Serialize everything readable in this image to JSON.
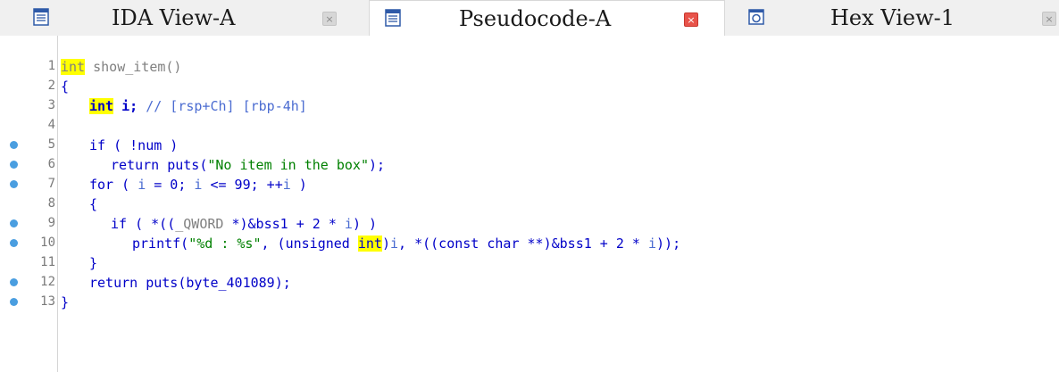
{
  "tabs": [
    {
      "label": "IDA View-A",
      "icon": "disassembly-view-icon",
      "close": "×"
    },
    {
      "label": "Pseudocode-A",
      "icon": "pseudocode-view-icon",
      "close": "×"
    },
    {
      "label": "Hex View-1",
      "icon": "hex-view-icon",
      "close": "×"
    }
  ],
  "code_lines": [
    {
      "n": "1"
    },
    {
      "n": "2"
    },
    {
      "n": "3"
    },
    {
      "n": "4"
    },
    {
      "n": "5"
    },
    {
      "n": "6"
    },
    {
      "n": "7"
    },
    {
      "n": "8"
    },
    {
      "n": "9"
    },
    {
      "n": "10"
    },
    {
      "n": "11"
    },
    {
      "n": "12"
    },
    {
      "n": "13"
    }
  ],
  "tokens": {
    "l1_int": "int",
    "l1_rest": " show_item()",
    "l2": "{",
    "l3_int": "int",
    "l3_i": " i; ",
    "l3_cm": "// [rsp+Ch] [rbp-4h]",
    "l5": "if ( !num )",
    "l6_a": "return puts(",
    "l6_str": "\"No item in the box\"",
    "l6_b": ");",
    "l7_a": "for ( ",
    "l7_i1": "i",
    "l7_b": " = 0; ",
    "l7_i2": "i",
    "l7_c": " <= 99; ++",
    "l7_i3": "i",
    "l7_d": " )",
    "l8": "{",
    "l9_a": "if ( *((",
    "l9_q": "_QWORD",
    "l9_b": " *)&bss1 + 2 * ",
    "l9_i": "i",
    "l9_c": ") )",
    "l10_a": "printf(",
    "l10_str": "\"%d : %s\"",
    "l10_b": ", (unsigned ",
    "l10_int": "int",
    "l10_c": ")",
    "l10_i1": "i",
    "l10_d": ", *((const char **)&bss1 + 2 * ",
    "l10_i2": "i",
    "l10_e": "));",
    "l11": "}",
    "l12": "return puts(byte_401089);",
    "l13": "}"
  },
  "colors": {
    "accent": "#4a9ee0",
    "highlight": "#ffff00",
    "keyword": "#0000c8",
    "string": "#008000",
    "close_active": "#e8534a"
  }
}
